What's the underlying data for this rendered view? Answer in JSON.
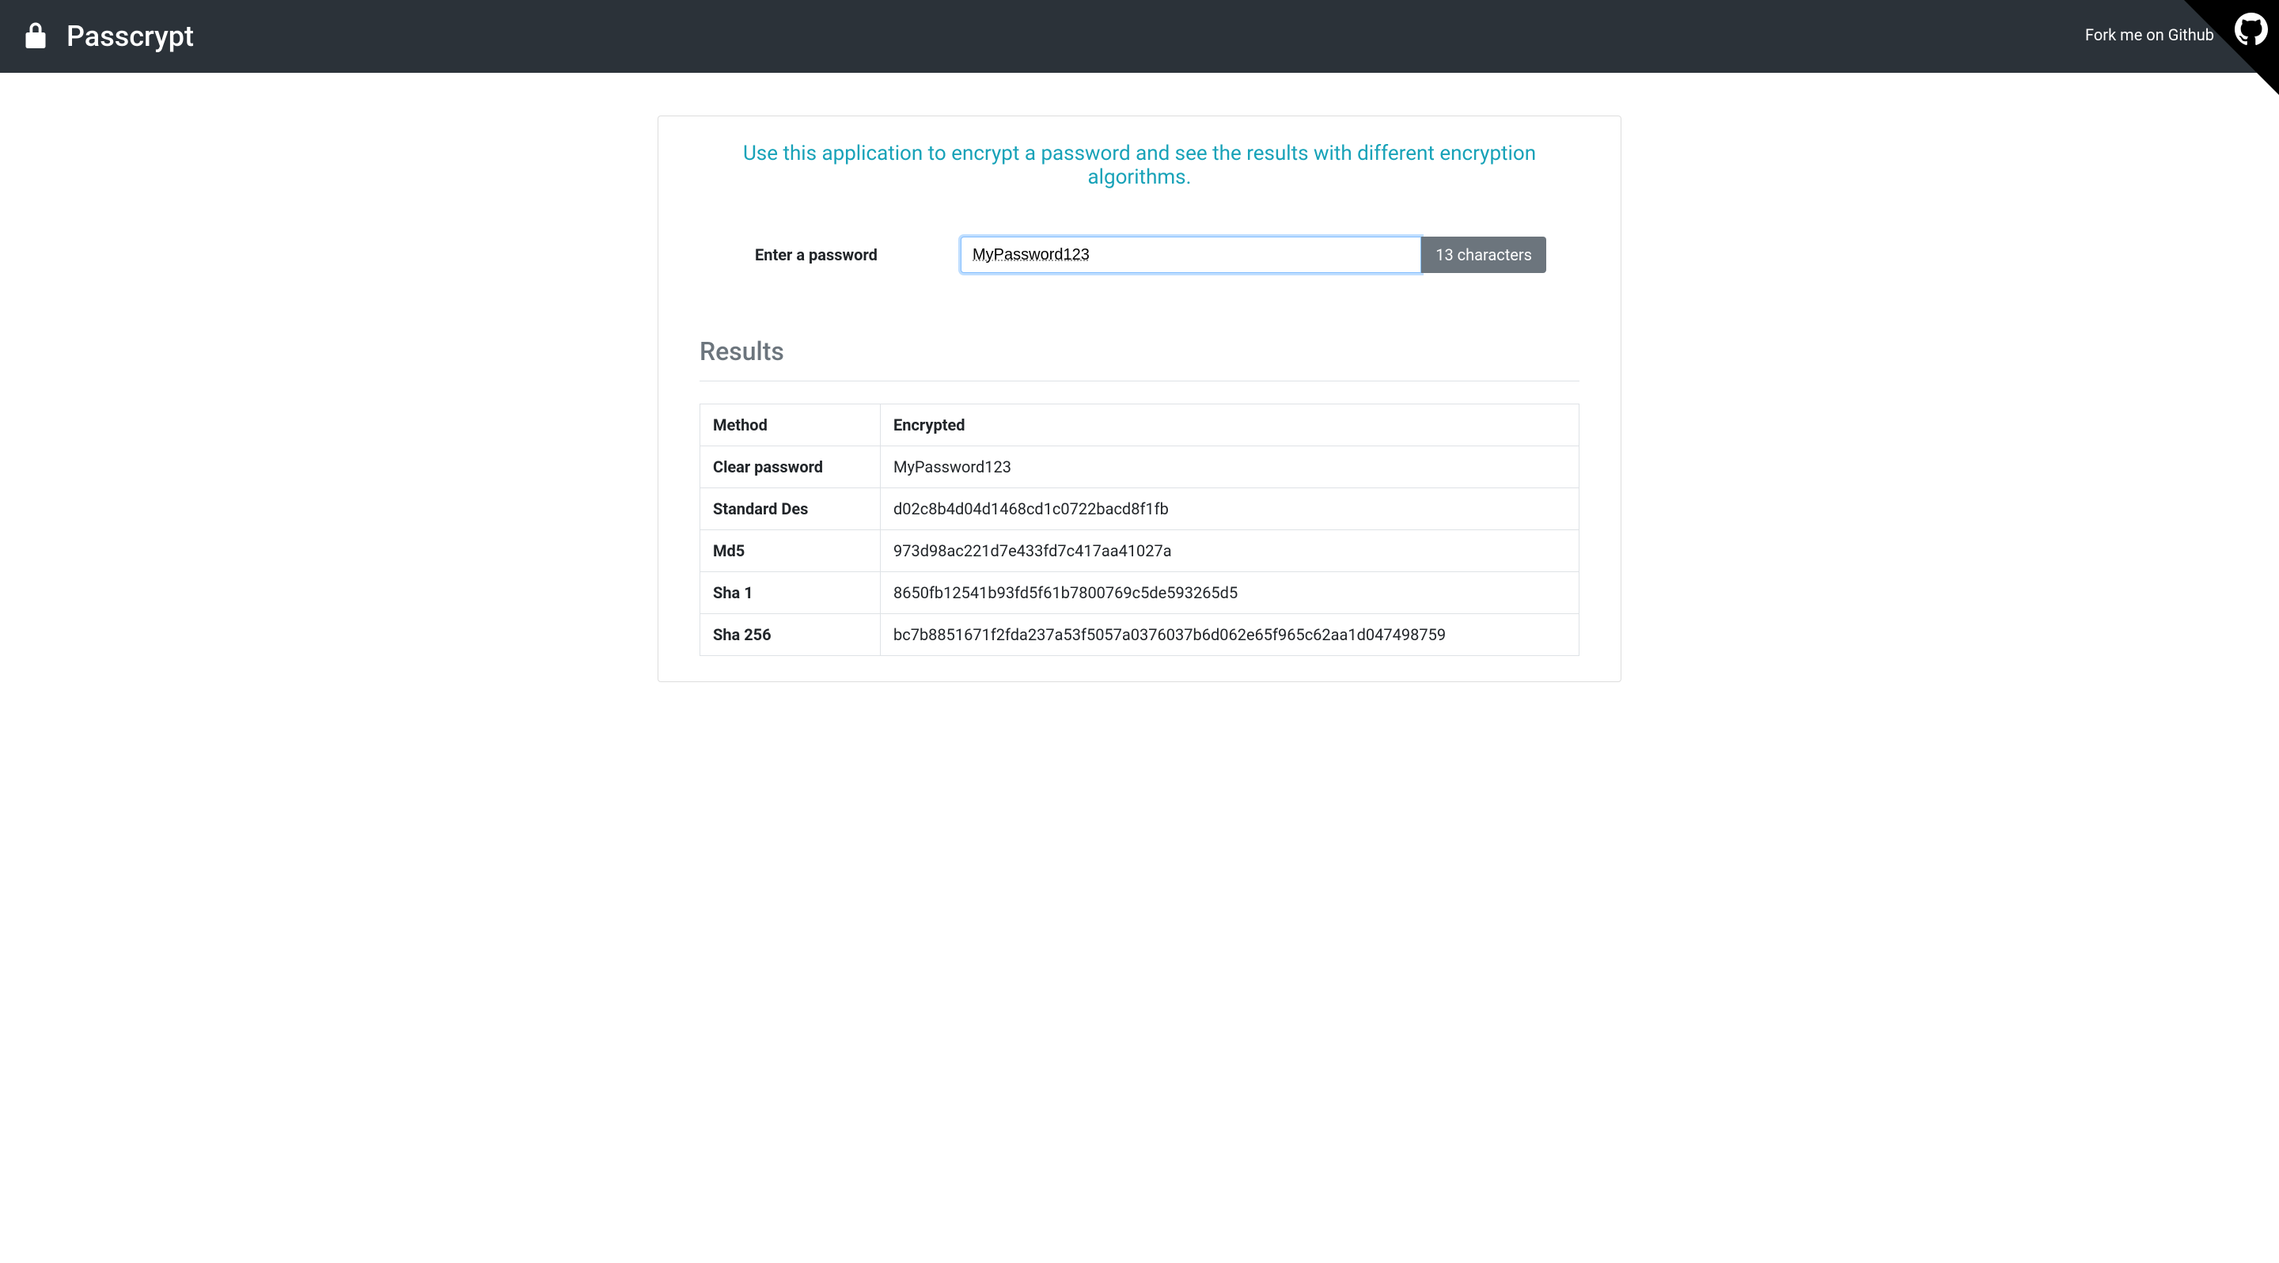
{
  "header": {
    "app_title": "Passcrypt",
    "fork_label": "Fork me on Github"
  },
  "main": {
    "description": "Use this application to encrypt a password and see the results with different encryption algorithms.",
    "form": {
      "label": "Enter a password",
      "value": "MyPassword123",
      "char_count": "13 characters"
    },
    "results": {
      "heading": "Results",
      "columns": {
        "method": "Method",
        "encrypted": "Encrypted"
      },
      "rows": [
        {
          "method": "Clear password",
          "value": "MyPassword123"
        },
        {
          "method": "Standard Des",
          "value": "d02c8b4d04d1468cd1c0722bacd8f1fb"
        },
        {
          "method": "Md5",
          "value": "973d98ac221d7e433fd7c417aa41027a"
        },
        {
          "method": "Sha 1",
          "value": "8650fb12541b93fd5f61b7800769c5de593265d5"
        },
        {
          "method": "Sha 256",
          "value": "bc7b8851671f2fda237a53f5057a0376037b6d062e65f965c62aa1d047498759"
        }
      ]
    }
  }
}
